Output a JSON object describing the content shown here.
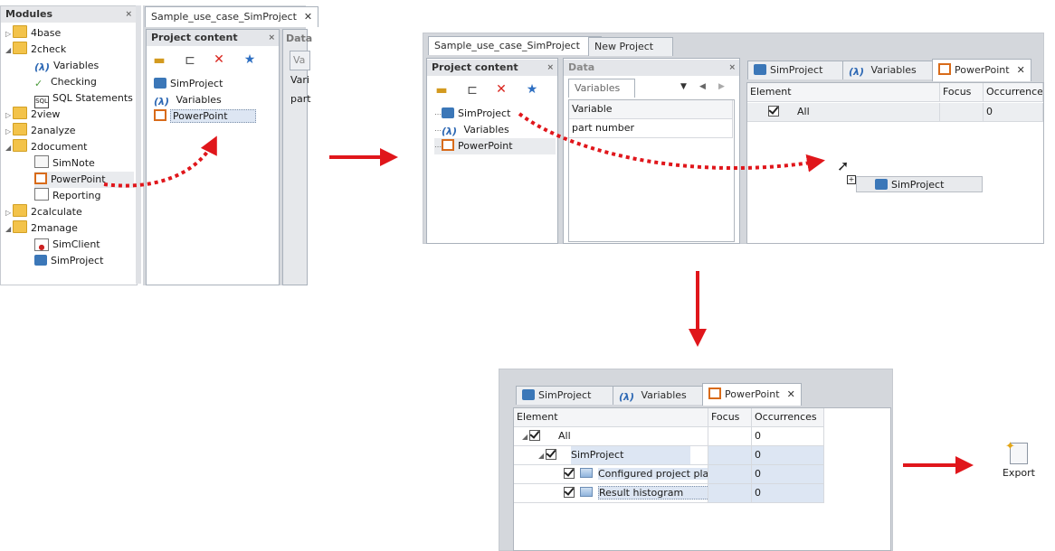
{
  "panel1": {
    "modules_header": "Modules",
    "tree": [
      {
        "label": "4base",
        "icon": "folder-icon",
        "level": 0
      },
      {
        "label": "2check",
        "icon": "folder-icon",
        "level": 0
      },
      {
        "label": "Variables",
        "icon": "lambda-icon",
        "level": 1
      },
      {
        "label": "Checking",
        "icon": "checkmark-icon",
        "level": 1
      },
      {
        "label": "SQL Statements",
        "icon": "sql-icon",
        "level": 1
      },
      {
        "label": "2view",
        "icon": "folder-icon",
        "level": 0
      },
      {
        "label": "2analyze",
        "icon": "folder-icon",
        "level": 0
      },
      {
        "label": "2document",
        "icon": "folder-icon",
        "level": 0
      },
      {
        "label": "SimNote",
        "icon": "note-icon",
        "level": 1
      },
      {
        "label": "PowerPoint",
        "icon": "powerpoint-icon",
        "level": 1
      },
      {
        "label": "Reporting",
        "icon": "report-icon",
        "level": 1
      },
      {
        "label": "2calculate",
        "icon": "folder-icon",
        "level": 0
      },
      {
        "label": "2manage",
        "icon": "folder-icon",
        "level": 0
      },
      {
        "label": "SimClient",
        "icon": "client-icon",
        "level": 1
      },
      {
        "label": "SimProject",
        "icon": "briefcase-icon",
        "level": 1
      }
    ],
    "doc_tab": "Sample_use_case_SimProject",
    "project_content_title": "Project content",
    "project_items": [
      "SimProject",
      "Variables",
      "PowerPoint"
    ],
    "data_title_partial": "Data",
    "vari_partial": "Vari",
    "part_partial": "part"
  },
  "panel2": {
    "doc_tab": "Sample_use_case_SimProject",
    "new_tab": "New Project",
    "project_content_title": "Project content",
    "project_items": [
      "SimProject",
      "Variables",
      "PowerPoint"
    ],
    "data_title": "Data",
    "data_tab": "Variables",
    "variable_header": "Variable",
    "variable_value": "part number",
    "right_tabs": [
      "SimProject",
      "Variables",
      "PowerPoint"
    ],
    "col_element": "Element",
    "col_focus": "Focus",
    "col_occ": "Occurrence",
    "all_label": "All",
    "all_occ": "0",
    "drag_label": "SimProject"
  },
  "panel3": {
    "tabs": [
      "SimProject",
      "Variables",
      "PowerPoint"
    ],
    "col_element": "Element",
    "col_focus": "Focus",
    "col_occ": "Occurrences",
    "rows": [
      {
        "label": "All",
        "occ": "0"
      },
      {
        "label": "SimProject",
        "occ": "0"
      },
      {
        "label": "Configured project plan",
        "occ": "0"
      },
      {
        "label": "Result histogram",
        "occ": "0"
      }
    ]
  },
  "export_label": "Export",
  "colors": {
    "arrow": "#e0161b",
    "accent": "#d86b1a",
    "selection": "#dde6f3"
  }
}
